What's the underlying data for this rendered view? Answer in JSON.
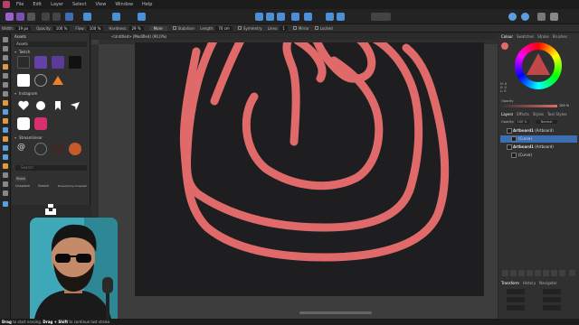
{
  "menu": [
    "File",
    "Edit",
    "Layer",
    "Select",
    "View",
    "Window",
    "Help"
  ],
  "context_toolbar": {
    "width_label": "Width:",
    "width_value": "19 px",
    "opacity_label": "Opacity:",
    "opacity_value": "100 %",
    "flow_label": "Flow:",
    "flow_value": "100 %",
    "hardness_label": "Hardness:",
    "hardness_value": "29 %",
    "more_label": "More",
    "stabiliser_label": "Stabiliser",
    "length_label": "Length:",
    "length_value": "70 cm",
    "symmetry_label": "Symmetry",
    "lines_label": "Lines:",
    "lines_value": "1",
    "mirror_label": "Mirror",
    "locked_label": "Locked"
  },
  "assets_panel": {
    "tab": "Assets",
    "selector": "Assets",
    "categories": [
      "Twitch",
      "Instagram",
      "Streamlinear"
    ],
    "search_placeholder": "Search",
    "stock_label": "Stock",
    "source_select": "Unsplash",
    "search_label": "Search",
    "powered_by": "Powered by Unsplash"
  },
  "document": {
    "tab_title": "<Untitled> (Modified) (90.0%)"
  },
  "colour_panel": {
    "tabs": [
      "Colour",
      "Swatches",
      "Stroke",
      "Brushes"
    ],
    "hsl": [
      {
        "label": "H:",
        "value": "0"
      },
      {
        "label": "S:",
        "value": "0"
      },
      {
        "label": "L:",
        "value": "0"
      }
    ],
    "opacity_label": "Opacity",
    "opacity_value": "100 %",
    "accent": "#e06a6a"
  },
  "layers_panel": {
    "tabs": [
      "Layers",
      "Effects",
      "Styles",
      "Text Styles"
    ],
    "opacity_label": "Opacity:",
    "opacity_value": "100 %",
    "blend_mode": "Normal",
    "layers": [
      {
        "name": "Artboard1",
        "type": "(Artboard)"
      },
      {
        "name": "(Curve)",
        "type": ""
      },
      {
        "name": "Artboard1",
        "type": "(Artboard)"
      },
      {
        "name": "(Curve)",
        "type": ""
      }
    ]
  },
  "bottom_panel": {
    "tabs": [
      "Transform",
      "History",
      "Navigator"
    ]
  },
  "status": {
    "key1": "Drag",
    "text1": "to start erasing.",
    "key2": "Drag + Shift",
    "text2": "to continue last stroke."
  }
}
